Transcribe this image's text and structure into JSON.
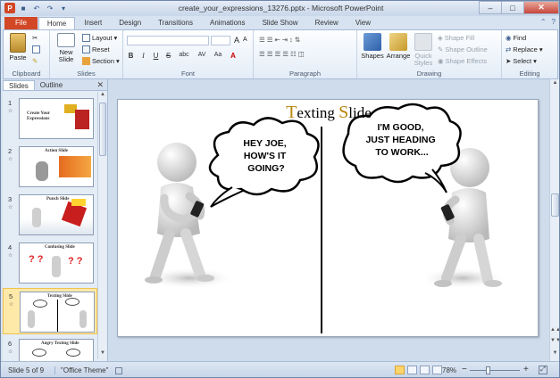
{
  "window": {
    "title": "create_your_expressions_13276.pptx - Microsoft PowerPoint",
    "app_icon": "P"
  },
  "ribbon_tabs": [
    "File",
    "Home",
    "Insert",
    "Design",
    "Transitions",
    "Animations",
    "Slide Show",
    "Review",
    "View"
  ],
  "active_tab": "Home",
  "clipboard": {
    "paste": "Paste",
    "label": "Clipboard"
  },
  "slides_group": {
    "new_slide": "New Slide",
    "layout": "Layout",
    "reset": "Reset",
    "section": "Section",
    "label": "Slides"
  },
  "font_group": {
    "label": "Font",
    "bold": "B",
    "italic": "I",
    "underline": "U",
    "strike": "S",
    "shadow": "abc",
    "spacing": "AV",
    "case": "Aa",
    "grow": "A",
    "shrink": "A"
  },
  "paragraph_group": {
    "label": "Paragraph"
  },
  "drawing_group": {
    "shapes": "Shapes",
    "arrange": "Arrange",
    "quick_styles": "Quick Styles",
    "shape_fill": "Shape Fill",
    "shape_outline": "Shape Outline",
    "shape_effects": "Shape Effects",
    "label": "Drawing"
  },
  "editing_group": {
    "find": "Find",
    "replace": "Replace",
    "select": "Select",
    "label": "Editing"
  },
  "panel": {
    "tabs": [
      "Slides",
      "Outline"
    ],
    "active": "Slides"
  },
  "thumbnails": [
    {
      "num": "1",
      "title": "Create Your Expressions",
      "selected": false
    },
    {
      "num": "2",
      "title": "Action Slide",
      "selected": false
    },
    {
      "num": "3",
      "title": "Punch Slide",
      "selected": false
    },
    {
      "num": "4",
      "title": "Confusing Slide",
      "selected": false
    },
    {
      "num": "5",
      "title": "Texting Slide",
      "selected": true
    },
    {
      "num": "6",
      "title": "Angry Texting Slide",
      "selected": false
    }
  ],
  "slide": {
    "title_first": "T",
    "title_rest": "exting ",
    "title_second_first": "S",
    "title_second_rest": "lide",
    "bubble_left": [
      "HEY JOE,",
      "HOW'S IT",
      "GOING?"
    ],
    "bubble_right": [
      "I'M GOOD,",
      "JUST HEADING",
      "TO WORK..."
    ]
  },
  "status": {
    "slide_info": "Slide 5 of 9",
    "theme": "\"Office Theme\"",
    "zoom": "78%"
  },
  "colors": {
    "file_tab": "#d24726",
    "title_gold": "#b8860b",
    "selection": "#ffe9a8"
  }
}
